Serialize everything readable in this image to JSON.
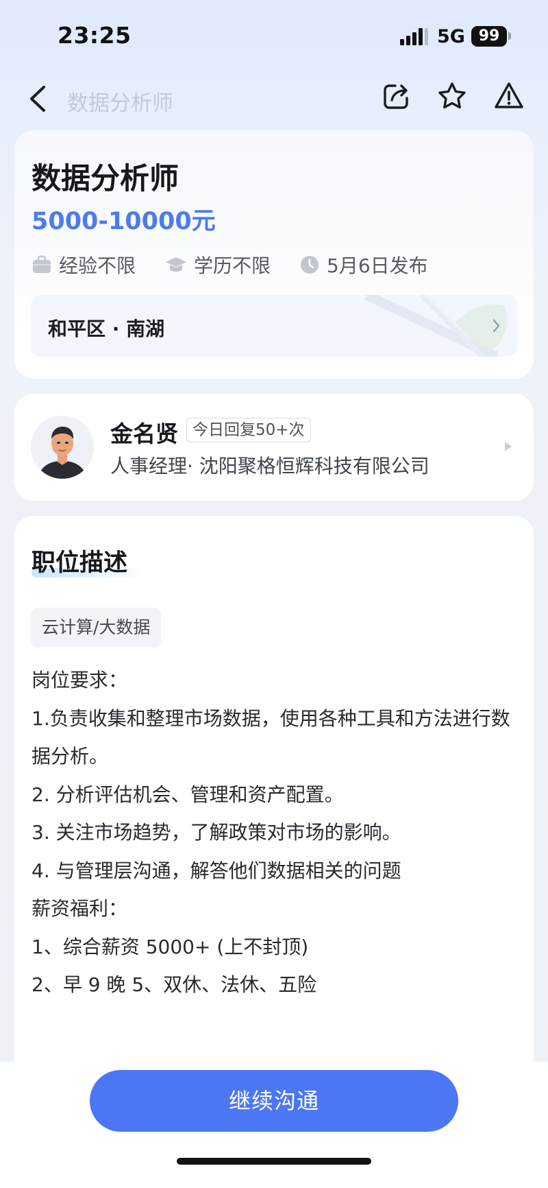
{
  "status_bar": {
    "time": "23:25",
    "network": "5G",
    "battery": "99"
  },
  "nav": {
    "title": "数据分析师"
  },
  "job": {
    "title": "数据分析师",
    "salary": "5000-10000元",
    "experience": "经验不限",
    "education": "学历不限",
    "posted": "5月6日发布",
    "location": "和平区 · 南湖"
  },
  "recruiter": {
    "name": "金名贤",
    "badge": "今日回复50+次",
    "title_company": "人事经理· 沈阳聚格恒辉科技有限公司"
  },
  "description": {
    "section_title": "职位描述",
    "tag": "云计算/大数据",
    "lines": [
      "岗位要求：",
      "1.负责收集和整理市场数据，使用各种工具和方法进行数据分析。",
      "2. 分析评估机会、管理和资产配置。",
      "3. 关注市场趋势，了解政策对市场的影响。",
      "4. 与管理层沟通，解答他们数据相关的问题",
      "薪资福利：",
      "1、综合薪资 5000+ (上不封顶)",
      "2、早 9 晚 5、双休、法休、五险"
    ]
  },
  "footer": {
    "button_label": "继续沟通"
  }
}
